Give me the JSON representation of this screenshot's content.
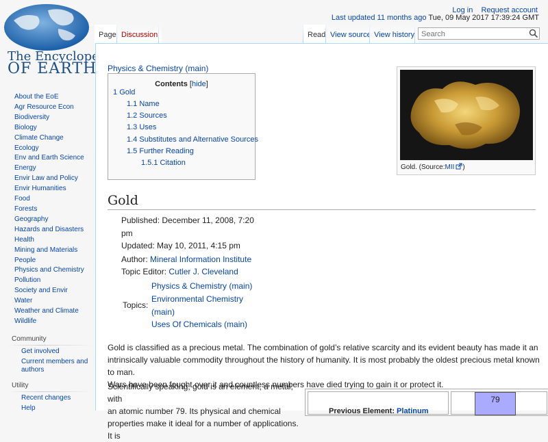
{
  "personal": {
    "login": "Log in",
    "request_account": "Request account"
  },
  "last_updated": {
    "label": "Last updated",
    "ago": "11 months ago",
    "date": "Tue, 09 May 2017 17:39:24 GMT"
  },
  "logo": {
    "line1": "The Encyclopedia",
    "line2": "OF EARTH"
  },
  "tabs": {
    "page": "Page",
    "discussion": "Discussion",
    "read": "Read",
    "view_source": "View source",
    "view_history": "View history"
  },
  "search": {
    "placeholder": "Search"
  },
  "sidebar": {
    "items": [
      "About the EoE",
      "Agr Resource Econ",
      "Biodiversity",
      "Biology",
      "Climate Change",
      "Ecology",
      "Env and Earth Science",
      "Energy",
      "Envir Law and Policy",
      "Envir Humanities",
      "Food",
      "Forests",
      "Geography",
      "Hazards and Disasters",
      "Health",
      "Mining and Materials",
      "People",
      "Physics and Chemistry",
      "Pollution",
      "Society and Envir",
      "Water",
      "Weather and Climate",
      "Wildlife"
    ],
    "community": {
      "heading": "Community",
      "items": [
        "Get involved",
        "Current members and authors"
      ]
    },
    "utility": {
      "heading": "Utility",
      "items": [
        "Recent changes",
        "Help"
      ]
    }
  },
  "content": {
    "category_link": "Physics & Chemistry (main)",
    "toc": {
      "title": "Contents",
      "hide": "hide",
      "entries": [
        {
          "num": "1",
          "text": "Gold"
        },
        {
          "num": "1.1",
          "text": "Name"
        },
        {
          "num": "1.2",
          "text": "Sources"
        },
        {
          "num": "1.3",
          "text": "Uses"
        },
        {
          "num": "1.4",
          "text": "Substitutes and Alternative Sources"
        },
        {
          "num": "1.5",
          "text": "Further Reading"
        },
        {
          "num": "1.5.1",
          "text": "Citation"
        }
      ]
    },
    "thumb": {
      "caption_prefix": "Gold. (Source:",
      "caption_link": "MII",
      "caption_suffix": ")"
    },
    "heading": "Gold",
    "meta": {
      "published_line1": "Published: December 11, 2008, 7:20",
      "published_line2": "pm",
      "updated": "Updated: May 10, 2011, 4:15 pm",
      "author_label": "Author:",
      "author": "Mineral Information Institute",
      "editor_label": "Topic Editor:",
      "editor": "Cutler J. Cleveland",
      "topics_label": "Topics:",
      "topics": [
        "Physics & Chemistry (main)",
        "Environmental Chemistry",
        "(main)",
        "Uses Of Chemicals (main)"
      ]
    },
    "para1": [
      "Gold is classified as a precious metal. The combination of gold’s relative scarcity and its evident beauty has made it an",
      "intrinsically valuable commodity throughout the history of humanity. It is most probably the oldest precious metal known to man.",
      "Wars have been fought over it and countless numbers have died trying to gain it or protect it."
    ],
    "para2": [
      "Scientifically speaking, gold is an element, a metal, with",
      "an atomic number 79. Its physical and chemical",
      "properties make it ideal for a number of applications. It is"
    ],
    "infobox": {
      "atomic_number": "79",
      "prev_label": "Previous Element:",
      "prev_value": "Platinum"
    }
  },
  "colors": {
    "link": "#0645ad",
    "page_bg": "#f6f6f6",
    "content_bg": "#ffffff",
    "tab_border": "#a7d7f9",
    "atomic_box": "#aaaaff"
  }
}
